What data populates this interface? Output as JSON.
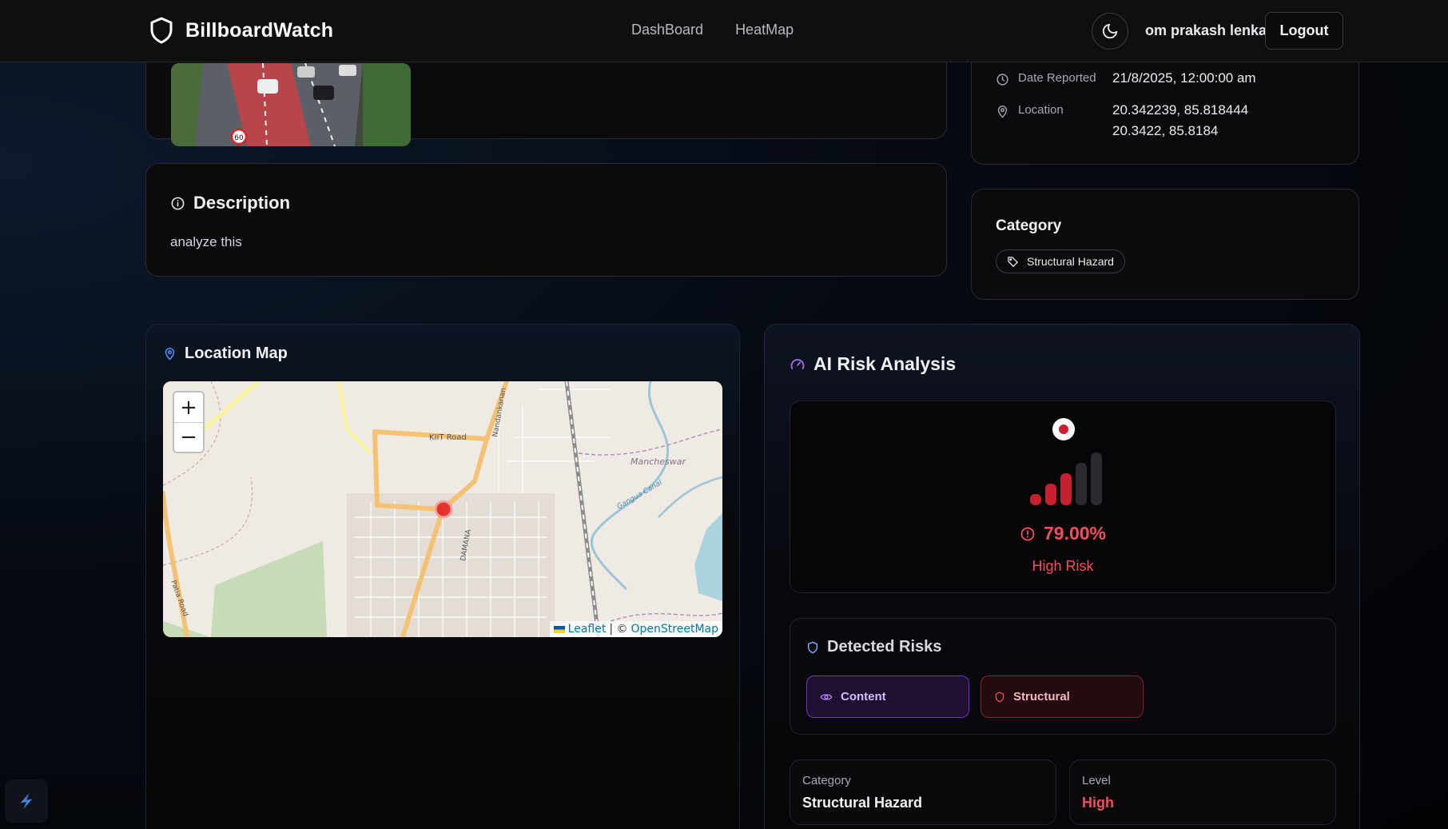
{
  "header": {
    "brand": "BillboardWatch",
    "nav": [
      "DashBoard",
      "HeatMap"
    ],
    "username": "om prakash lenka",
    "logout_label": "Logout"
  },
  "report_info": {
    "date_label": "Date Reported",
    "date_value": "21/8/2025, 12:00:00 am",
    "location_label": "Location",
    "location_line1": "20.342239, 85.818444",
    "location_line2": "20.3422, 85.8184"
  },
  "description": {
    "title": "Description",
    "text": "analyze this"
  },
  "category": {
    "title": "Category",
    "chip": "Structural Hazard"
  },
  "map": {
    "title": "Location Map",
    "zoom_in": "+",
    "zoom_out": "−",
    "attribution_leaflet": "Leaflet",
    "attribution_sep": "| ©",
    "attribution_osm": "OpenStreetMap",
    "labels": {
      "kiit": "KIIT Road",
      "mancheswar": "Mancheswar",
      "ganga": "Gangua Canal",
      "nandankanan": "Nandankanan",
      "damana": "DAMANA",
      "patia": "Patia Road"
    }
  },
  "ai": {
    "title": "AI Risk Analysis",
    "score": "79.00%",
    "score_fraction": 0.79,
    "risk_label": "High Risk",
    "detected_title": "Detected Risks",
    "risks": [
      "Content",
      "Structural"
    ],
    "category_label": "Category",
    "category_value": "Structural Hazard",
    "level_label": "Level",
    "level_value": "High"
  },
  "colors": {
    "accent_red": "#f0505c",
    "bar_active": "#c8202e",
    "content_purple": "#6c35c9",
    "map_marker": "#e52222"
  }
}
